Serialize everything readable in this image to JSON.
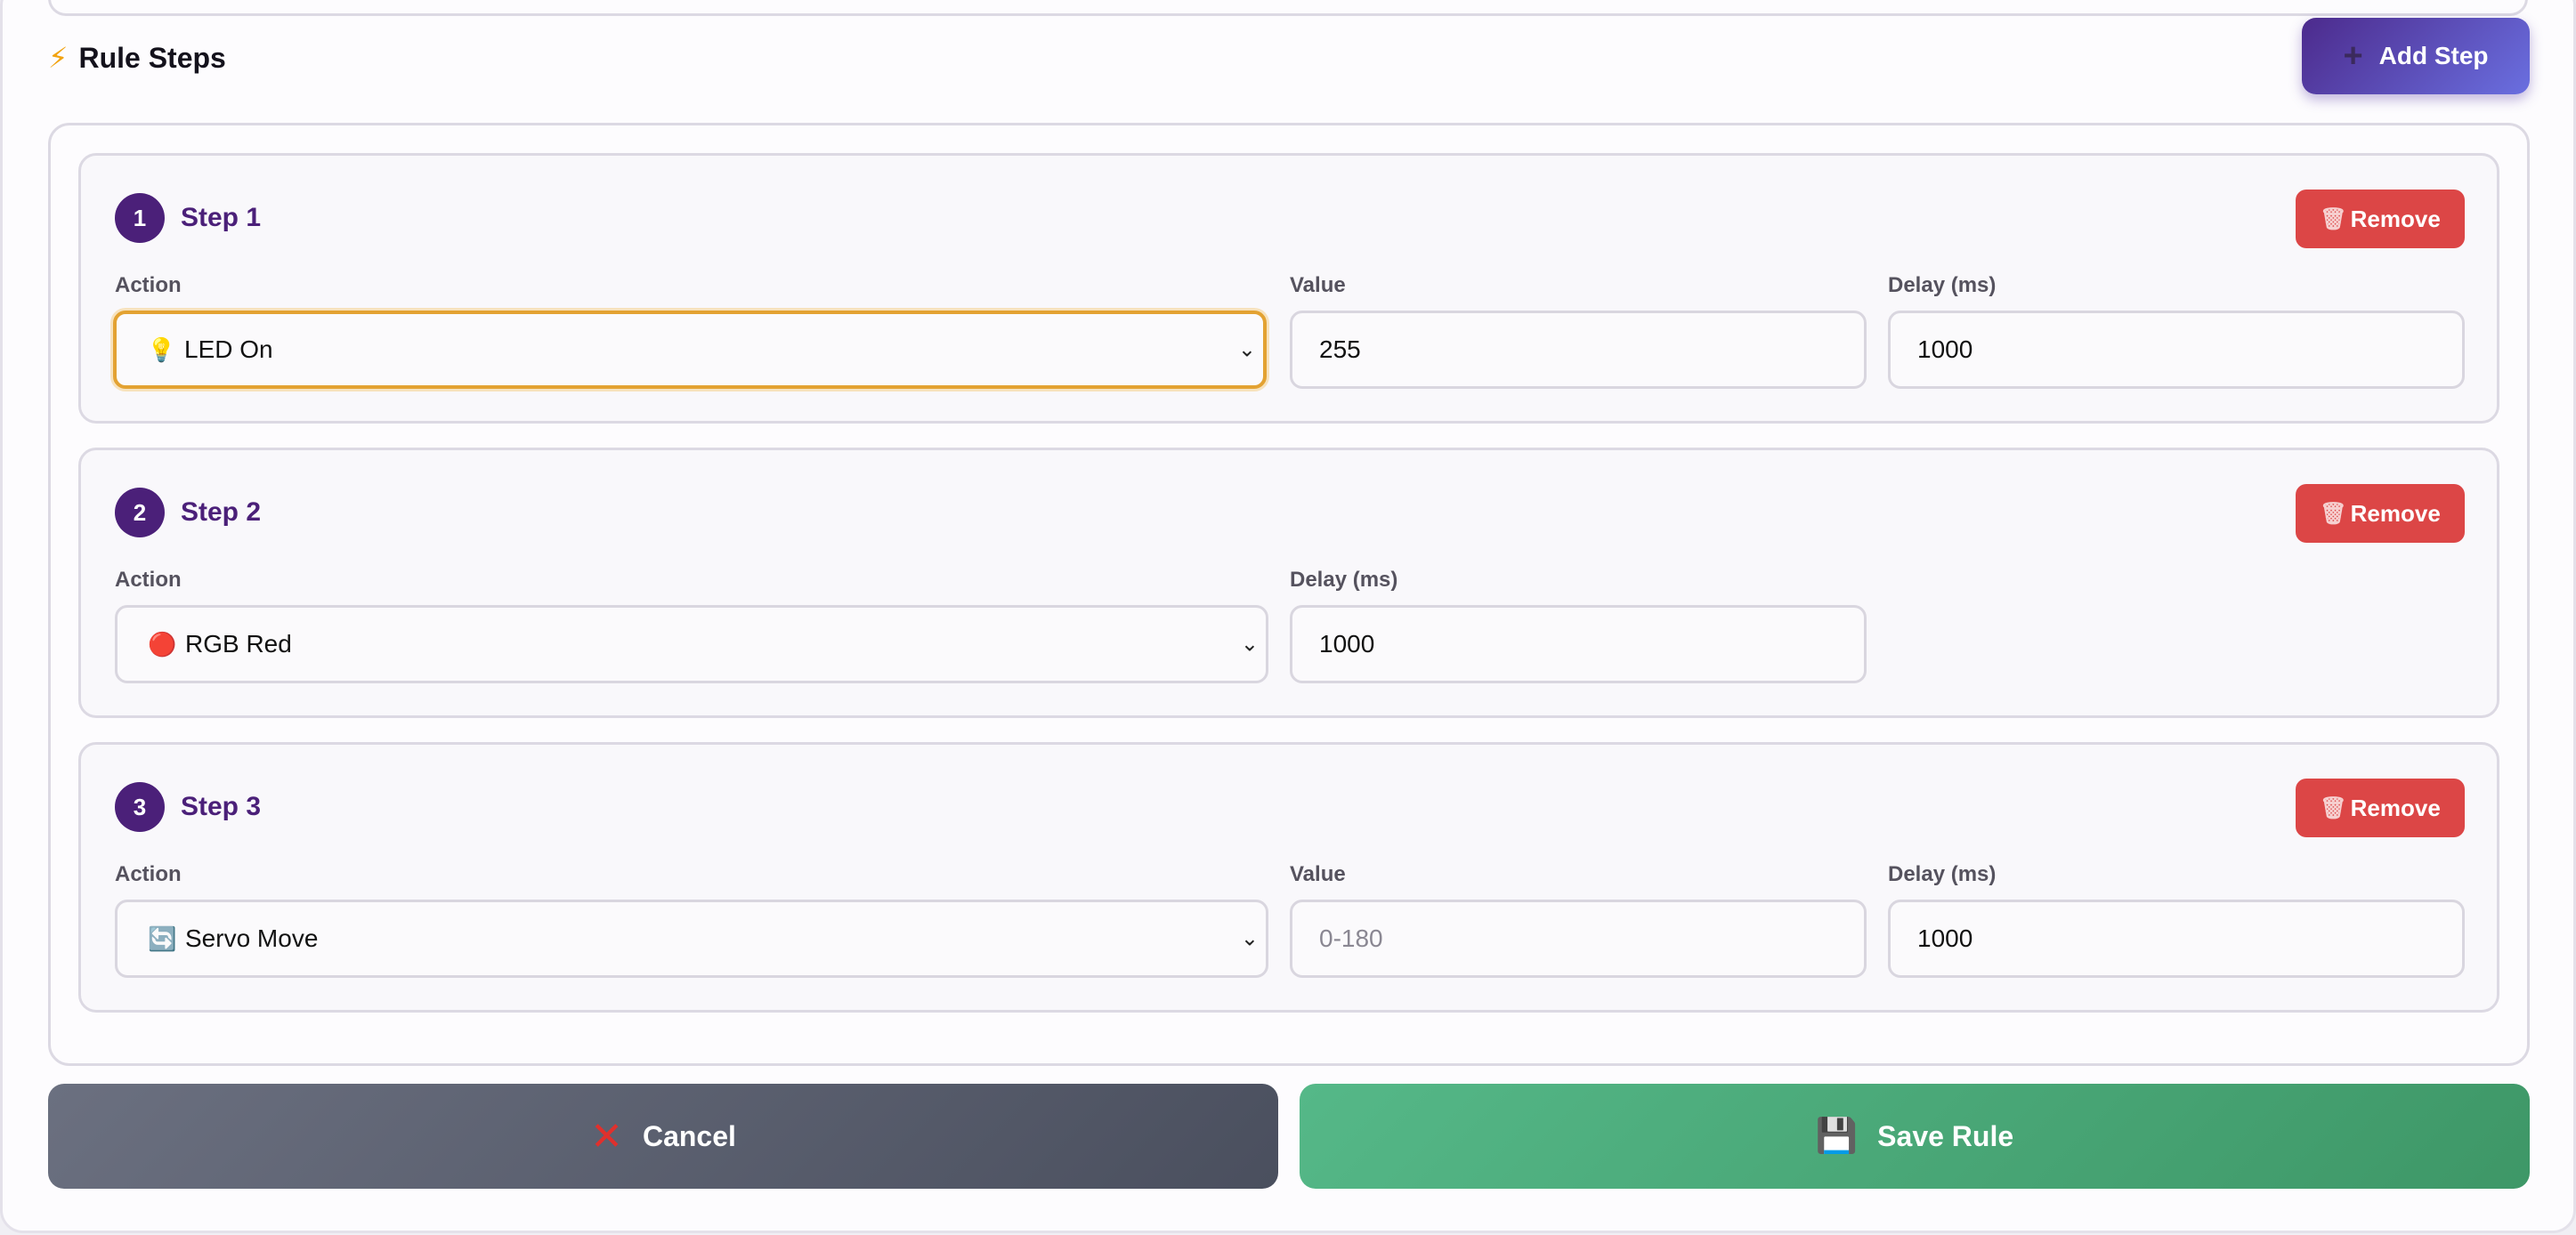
{
  "section": {
    "title": "Rule Steps",
    "icon": "lightning-bolt-icon",
    "add_step_label": "Add Step"
  },
  "steps": [
    {
      "number": "1",
      "title": "Step 1",
      "remove_label": "Remove",
      "action_label": "Action",
      "action_icon": "💡",
      "action_value": "LED On",
      "value_label": "Value",
      "value": "255",
      "value_placeholder": "",
      "delay_label": "Delay (ms)",
      "delay": "1000"
    },
    {
      "number": "2",
      "title": "Step 2",
      "remove_label": "Remove",
      "action_label": "Action",
      "action_icon": "🔴",
      "action_value": "RGB Red",
      "delay_label": "Delay (ms)",
      "delay": "1000"
    },
    {
      "number": "3",
      "title": "Step 3",
      "remove_label": "Remove",
      "action_label": "Action",
      "action_icon": "🔄",
      "action_value": "Servo Move",
      "value_label": "Value",
      "value": "",
      "value_placeholder": "0-180",
      "delay_label": "Delay (ms)",
      "delay": "1000"
    }
  ],
  "footer": {
    "cancel_label": "Cancel",
    "save_label": "Save Rule"
  },
  "colors": {
    "accent": "#4b2079",
    "remove": "#dc4646",
    "save": "#4aa978",
    "cancel": "#5a5f6e",
    "focus": "#e3a232"
  }
}
